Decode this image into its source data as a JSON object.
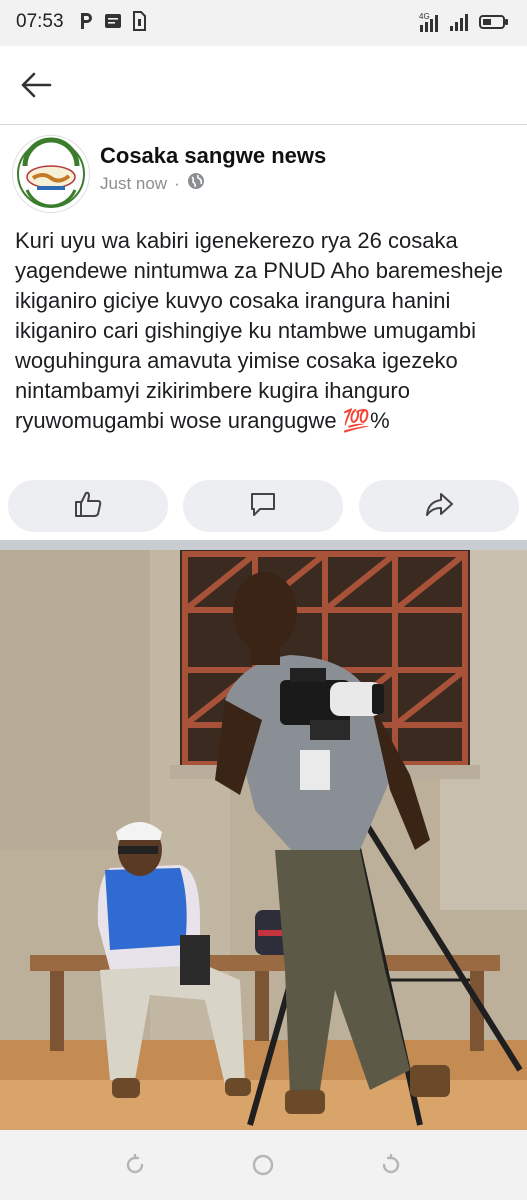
{
  "status_bar": {
    "time": "07:53",
    "left_icons": [
      "parking-icon",
      "message-icon",
      "sim-icon"
    ],
    "right_icons": [
      "network-4g-icon",
      "signal-icon",
      "signal-icon",
      "battery-icon"
    ]
  },
  "post": {
    "page_name": "Cosaka sangwe news",
    "time": "Just now",
    "separator": "·",
    "privacy_icon": "globe-icon",
    "text": "Kuri uyu wa kabiri igenekerezo rya 26 cosaka yagendewe nintumwa za PNUD Aho baremesheje ikiganiro giciye kuvyo cosaka irangura hanini ikiganiro cari gishingiye ku ntambwe umugambi woguhingura amavuta yimise cosaka igezeko nintambamyi zikirimbere kugira ihanguro ryuwomugambi wose urangugwe 💯%"
  },
  "actions": [
    "like-icon",
    "comment-icon",
    "share-icon"
  ],
  "nav": [
    "recents-icon",
    "home-icon",
    "back-icon"
  ]
}
